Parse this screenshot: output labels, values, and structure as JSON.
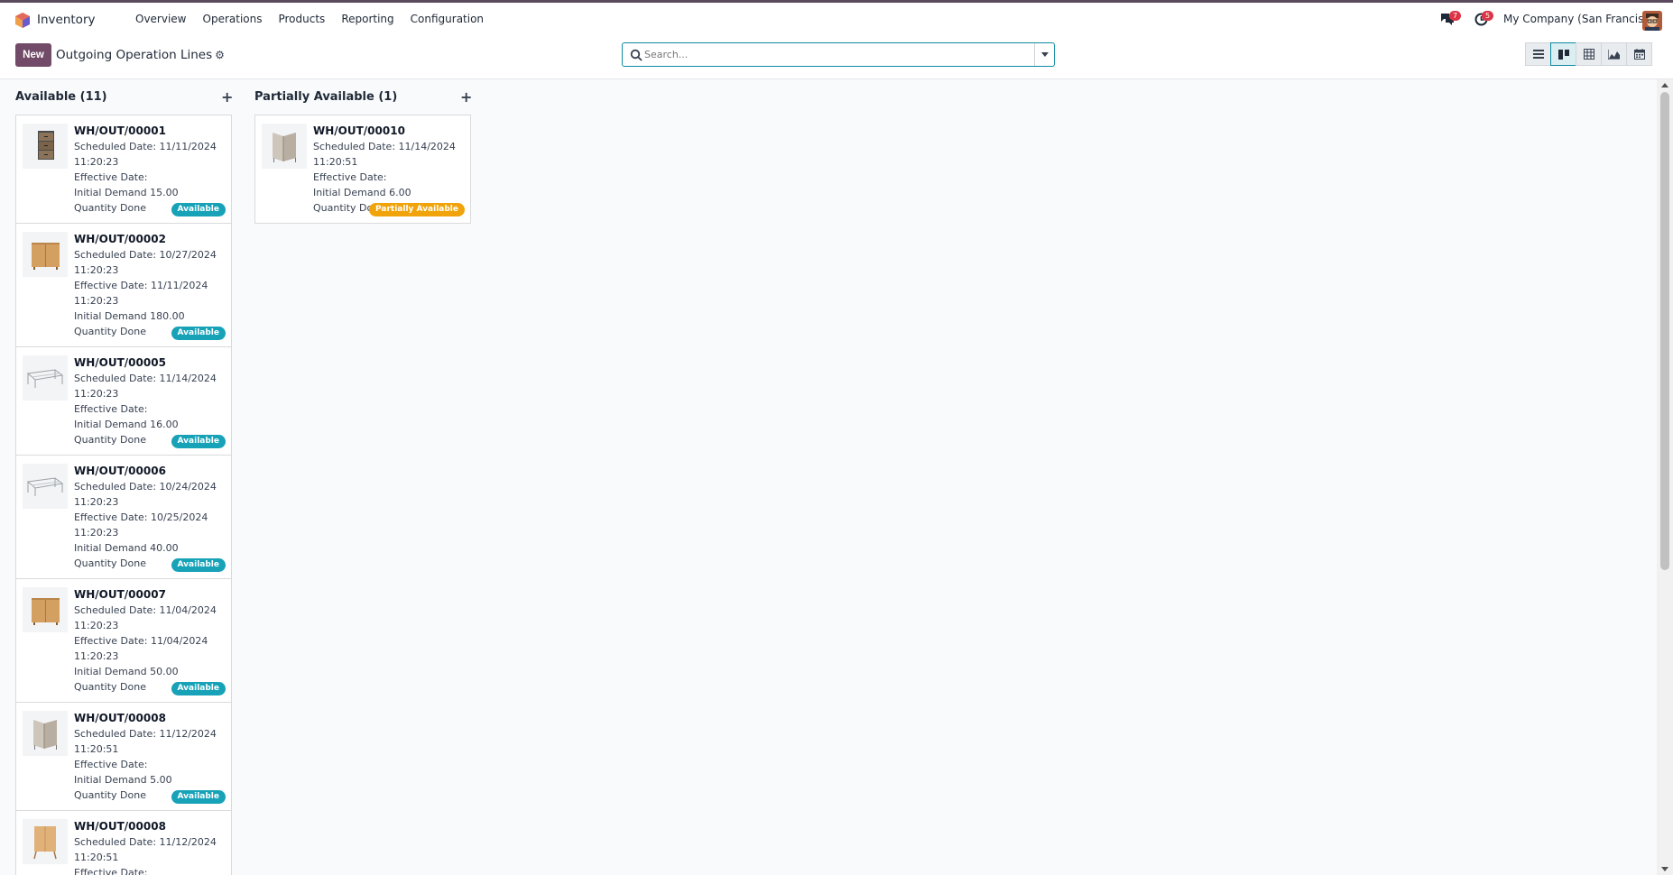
{
  "navbar": {
    "app_name": "Inventory",
    "menu": [
      "Overview",
      "Operations",
      "Products",
      "Reporting",
      "Configuration"
    ],
    "messages_count": "7",
    "activities_count": "5",
    "company": "My Company (San Francisco)"
  },
  "control": {
    "new_label": "New",
    "breadcrumb": "Outgoing Operation Lines",
    "search_placeholder": "Search...",
    "views": [
      "list-view-icon",
      "kanban-view-icon",
      "pivot-view-icon",
      "graph-view-icon",
      "calendar-view-icon"
    ],
    "active_view": "kanban"
  },
  "columns": [
    {
      "title": "Available (11)",
      "cards": [
        {
          "ref": "WH/OUT/00001",
          "scheduled": "Scheduled Date: 11/11/2024",
          "scheduled_time": "11:20:23",
          "effective": "Effective Date:",
          "effective_time": "",
          "demand": "Initial Demand 15.00",
          "done": "Quantity Done",
          "status": "Available",
          "image": "cabinet-drawers"
        },
        {
          "ref": "WH/OUT/00002",
          "scheduled": "Scheduled Date: 10/27/2024",
          "scheduled_time": "11:20:23",
          "effective": "Effective Date: 11/11/2024",
          "effective_time": "11:20:23",
          "demand": "Initial Demand 180.00",
          "done": "Quantity Done",
          "status": "Available",
          "image": "wood-cabinet"
        },
        {
          "ref": "WH/OUT/00005",
          "scheduled": "Scheduled Date: 11/14/2024",
          "scheduled_time": "11:20:23",
          "effective": "Effective Date:",
          "effective_time": "",
          "demand": "Initial Demand 16.00",
          "done": "Quantity Done",
          "status": "Available",
          "image": "wire-desk"
        },
        {
          "ref": "WH/OUT/00006",
          "scheduled": "Scheduled Date: 10/24/2024",
          "scheduled_time": "11:20:23",
          "effective": "Effective Date: 10/25/2024",
          "effective_time": "11:20:23",
          "demand": "Initial Demand 40.00",
          "done": "Quantity Done",
          "status": "Available",
          "image": "wire-desk"
        },
        {
          "ref": "WH/OUT/00007",
          "scheduled": "Scheduled Date: 11/04/2024",
          "scheduled_time": "11:20:23",
          "effective": "Effective Date: 11/04/2024",
          "effective_time": "11:20:23",
          "demand": "Initial Demand 50.00",
          "done": "Quantity Done",
          "status": "Available",
          "image": "wood-cabinet"
        },
        {
          "ref": "WH/OUT/00008",
          "scheduled": "Scheduled Date: 11/12/2024",
          "scheduled_time": "11:20:51",
          "effective": "Effective Date:",
          "effective_time": "",
          "demand": "Initial Demand 5.00",
          "done": "Quantity Done",
          "status": "Available",
          "image": "partition-screen"
        },
        {
          "ref": "WH/OUT/00008",
          "scheduled": "Scheduled Date: 11/12/2024",
          "scheduled_time": "11:20:51",
          "effective": "Effective Date:",
          "effective_time": "",
          "demand": "",
          "done": "",
          "status": "",
          "image": "wood-side-cabinet"
        }
      ]
    },
    {
      "title": "Partially Available (1)",
      "cards": [
        {
          "ref": "WH/OUT/00010",
          "scheduled": "Scheduled Date: 11/14/2024",
          "scheduled_time": "11:20:51",
          "effective": "Effective Date:",
          "effective_time": "",
          "demand": "Initial Demand 6.00",
          "done": "Quantity Done",
          "status": "Partially Available",
          "image": "partition-screen"
        }
      ]
    }
  ],
  "colors": {
    "brand": "#714b67",
    "accent": "#0d8aa1",
    "available": "#17a2b8",
    "partial": "#f0a30a"
  }
}
